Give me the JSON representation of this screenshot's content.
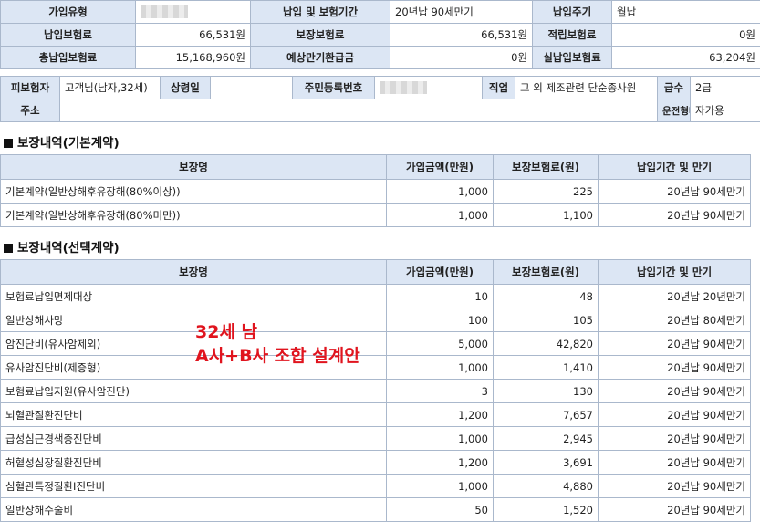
{
  "policy": {
    "rows": [
      [
        {
          "h": "가입유형"
        },
        {
          "v": "",
          "mask": true,
          "a": "lv"
        },
        {
          "h": "납입 및 보험기간"
        },
        {
          "v": "20년납 90세만기",
          "a": "lv"
        },
        {
          "h": "납입주기"
        },
        {
          "v": "월납",
          "a": "lv"
        }
      ],
      [
        {
          "h": "납입보험료"
        },
        {
          "v": "66,531원",
          "a": "val"
        },
        {
          "h": "보장보험료"
        },
        {
          "v": "66,531원",
          "a": "val"
        },
        {
          "h": "적립보험료"
        },
        {
          "v": "0원",
          "a": "val"
        }
      ],
      [
        {
          "h": "총납입보험료"
        },
        {
          "v": "15,168,960원",
          "a": "val"
        },
        {
          "h": "예상만기환급금"
        },
        {
          "v": "0원",
          "a": "val"
        },
        {
          "h": "실납입보험료"
        },
        {
          "v": "63,204원",
          "a": "val"
        }
      ]
    ]
  },
  "insured": {
    "label": "피보험자",
    "name": "고객님(남자,32세)",
    "age_label": "상령일",
    "age_value": "",
    "id_label": "주민등록번호",
    "job_label": "직업",
    "job_value": "그 외 제조관련 단순종사원",
    "grade_label": "급수",
    "grade_value": "2급",
    "address_label": "주소",
    "address_value": "",
    "drive_label": "운전형태",
    "drive_value": "자가용"
  },
  "columns": [
    "보장명",
    "가입금액(만원)",
    "보장보험료(원)",
    "납입기간 및 만기"
  ],
  "basic": {
    "title": "보장내역(기본계약)",
    "rows": [
      [
        "기본계약(일반상해후유장해(80%이상))",
        "1,000",
        "225",
        "20년납 90세만기"
      ],
      [
        "기본계약(일반상해후유장해(80%미만))",
        "1,000",
        "1,100",
        "20년납 90세만기"
      ]
    ]
  },
  "optional": {
    "title": "보장내역(선택계약)",
    "rows": [
      [
        "보험료납입면제대상",
        "10",
        "48",
        "20년납 20년만기"
      ],
      [
        "일반상해사망",
        "100",
        "105",
        "20년납 80세만기"
      ],
      [
        "암진단비(유사암제외)",
        "5,000",
        "42,820",
        "20년납 90세만기"
      ],
      [
        "유사암진단비(제증형)",
        "1,000",
        "1,410",
        "20년납 90세만기"
      ],
      [
        "보험료납입지원(유사암진단)",
        "3",
        "130",
        "20년납 90세만기"
      ],
      [
        "뇌혈관질환진단비",
        "1,200",
        "7,657",
        "20년납 90세만기"
      ],
      [
        "급성심근경색증진단비",
        "1,000",
        "2,945",
        "20년납 90세만기"
      ],
      [
        "허혈성심장질환진단비",
        "1,200",
        "3,691",
        "20년납 90세만기"
      ],
      [
        "심혈관특정질환Ⅰ진단비",
        "1,000",
        "4,880",
        "20년납 90세만기"
      ],
      [
        "일반상해수술비",
        "50",
        "1,520",
        "20년납 90세만기"
      ]
    ]
  },
  "overlay": {
    "line1": "32세 남",
    "line2": "A사+B사 조합 설계안",
    "color": "#e0141e"
  }
}
